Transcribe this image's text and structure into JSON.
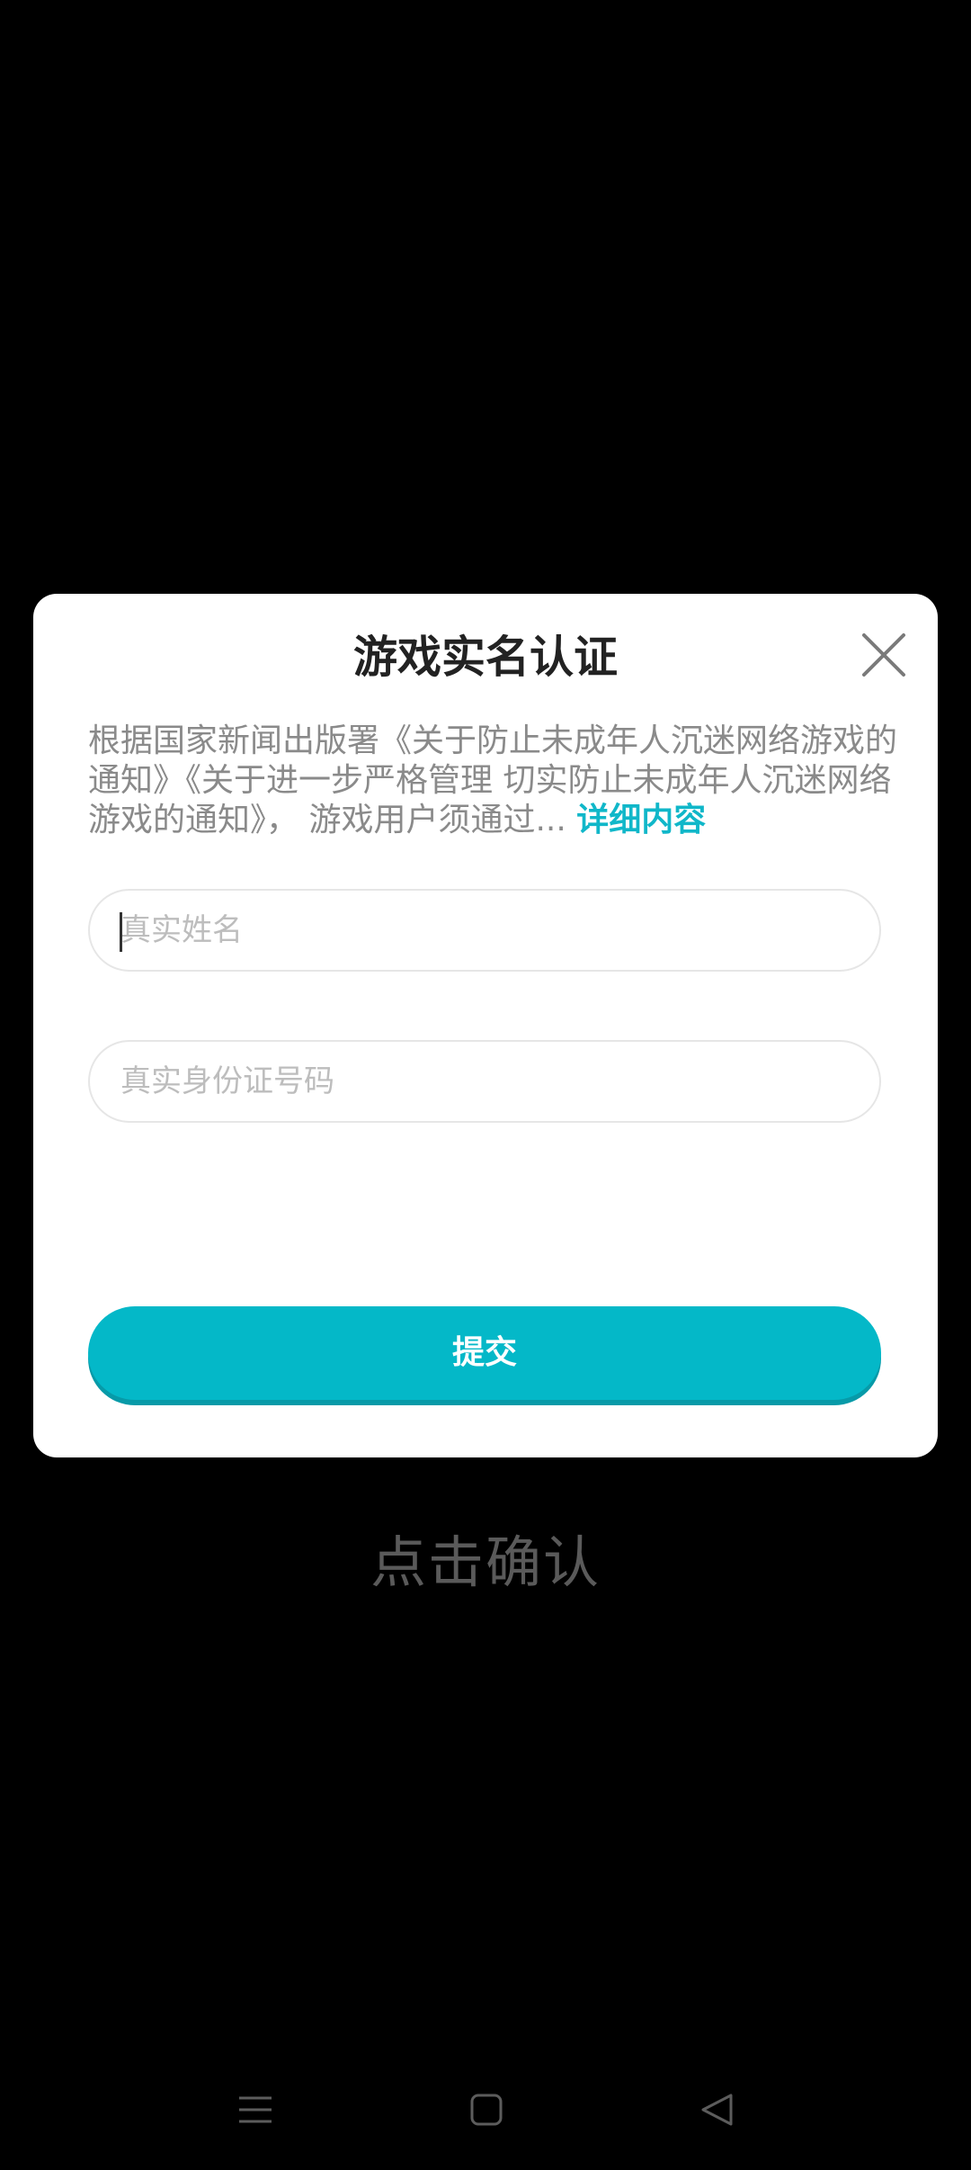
{
  "dialog": {
    "title": "游戏实名认证",
    "notice_text": "根据国家新闻出版署《关于防止未成年人沉迷网络游戏的通知》《关于进一步严格管理 切实防止未成年人沉迷网络游戏的通知》， 游戏用户须通过... ",
    "notice_link": "详细内容",
    "name_placeholder": "真实姓名",
    "id_placeholder": "真实身份证号码",
    "submit_label": "提交",
    "close_icon": "close-icon",
    "accent_color": "#04b8c8"
  },
  "background": {
    "confirm_text": "点击确认"
  },
  "navbar": {
    "icons": [
      "menu-icon",
      "home-icon",
      "back-icon"
    ]
  }
}
